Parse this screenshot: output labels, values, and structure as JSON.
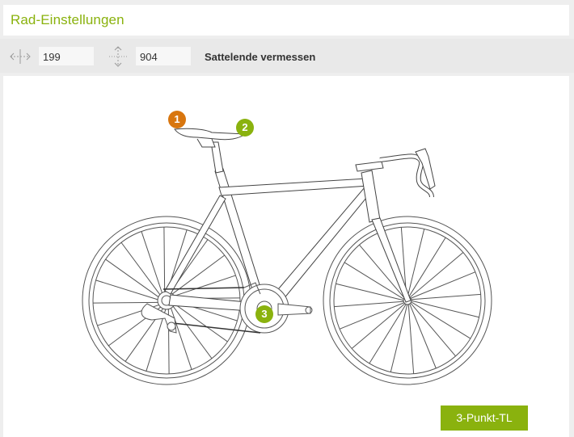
{
  "header": {
    "title": "Rad-Einstellungen"
  },
  "toolbar": {
    "horizontal_value": "199",
    "vertical_value": "904",
    "label": "Sattelende vermessen",
    "horizontal_icon": "horizontal-arrow-icon",
    "vertical_icon": "vertical-arrow-icon"
  },
  "markers": {
    "m1": {
      "label": "1",
      "color": "#d8760f"
    },
    "m2": {
      "label": "2",
      "color": "#8ab20e"
    },
    "m3": {
      "label": "3",
      "color": "#8ab20e"
    }
  },
  "method_button": {
    "label": "3-Punkt-TL"
  },
  "colors": {
    "accent": "#8ab20e",
    "marker_orange": "#d8760f"
  }
}
